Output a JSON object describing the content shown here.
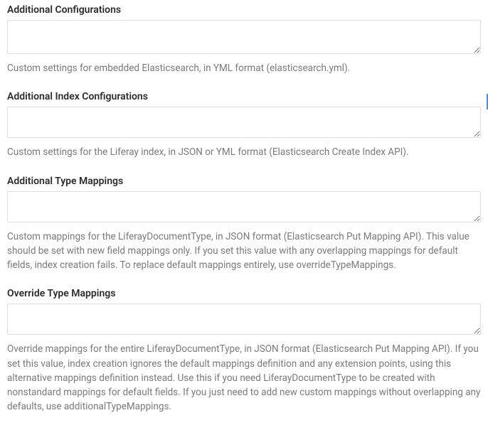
{
  "fields": [
    {
      "label": "Additional Configurations",
      "value": "",
      "help": "Custom settings for embedded Elasticsearch, in YML format (elasticsearch.yml)."
    },
    {
      "label": "Additional Index Configurations",
      "value": "",
      "help": "Custom settings for the Liferay index, in JSON or YML format (Elasticsearch Create Index API)."
    },
    {
      "label": "Additional Type Mappings",
      "value": "",
      "help": "Custom mappings for the LiferayDocumentType, in JSON format (Elasticsearch Put Mapping API). This value should be set with new field mappings only. If you set this value with any overlapping mappings for default fields, index creation fails. To replace default mappings entirely, use overrideTypeMappings."
    },
    {
      "label": "Override Type Mappings",
      "value": "",
      "help": "Override mappings for the entire LiferayDocumentType, in JSON format (Elasticsearch Put Mapping API). If you set this value, index creation ignores the default mappings definition and any extension points, using this alternative mappings definition instead. Use this if you need LiferayDocumentType to be created with nonstandard mappings for default fields. If you just need to add new custom mappings without overlapping any defaults, use additionalTypeMappings."
    }
  ]
}
